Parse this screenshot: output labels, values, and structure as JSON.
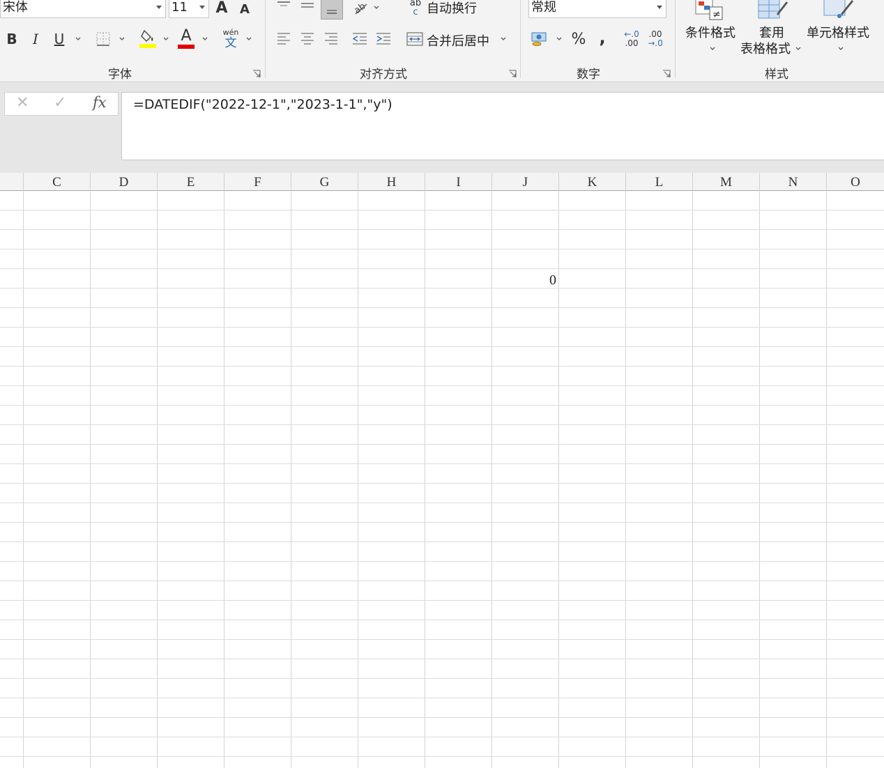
{
  "ribbon": {
    "font_group": {
      "label": "字体",
      "font_name": "宋体",
      "font_size": "11",
      "grow_label": "A",
      "shrink_label": "A",
      "bold": "B",
      "italic": "I",
      "underline": "U",
      "phonetic_top": "wén",
      "phonetic_bottom": "文",
      "font_color_label": "A",
      "highlight_color": "#ffff00",
      "font_color": "#e00000"
    },
    "align_group": {
      "label": "对齐方式",
      "wrap_text": "自动换行",
      "wrap_icon_top": "ab",
      "wrap_icon_bottom": "c",
      "merge_center": "合并后居中"
    },
    "number_group": {
      "label": "数字",
      "format": "常规",
      "percent": "%",
      "comma": ",",
      "inc_decimal_top": "←.0",
      "inc_decimal_bottom": ".00",
      "dec_decimal_top": ".00",
      "dec_decimal_bottom": "→.0"
    },
    "styles_group": {
      "label": "样式",
      "conditional": "条件格式",
      "table_format_1": "套用",
      "table_format_2": "表格格式",
      "cell_styles": "单元格样式"
    }
  },
  "formula_bar": {
    "cancel": "✕",
    "enter": "✓",
    "fx": "fx",
    "formula": "=DATEDIF(\"2022-12-1\",\"2023-1-1\",\"y\")"
  },
  "grid": {
    "columns": [
      "C",
      "D",
      "E",
      "F",
      "G",
      "H",
      "I",
      "J",
      "K",
      "L",
      "M",
      "N",
      "O"
    ],
    "cells": [
      {
        "col": "J",
        "row_index": 4,
        "value": "0"
      }
    ]
  }
}
